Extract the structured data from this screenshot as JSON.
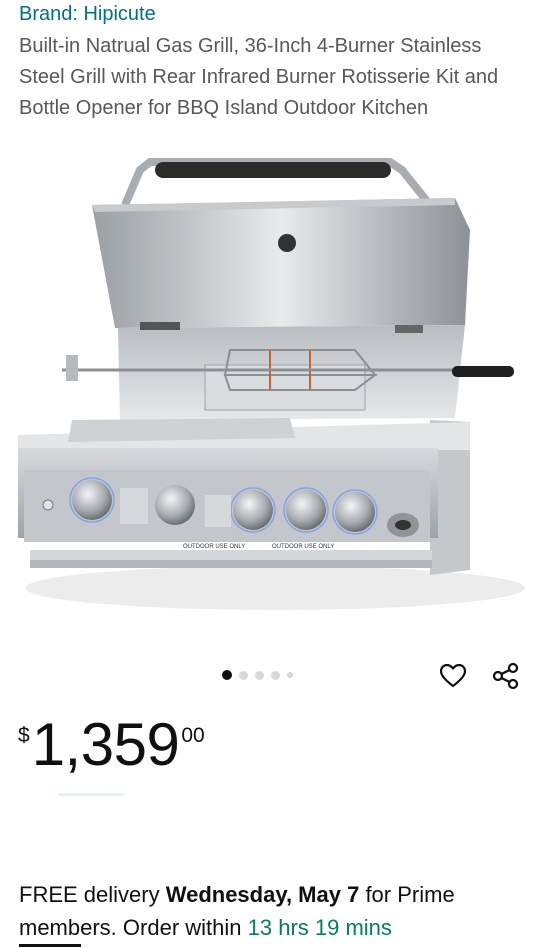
{
  "brand": {
    "label": "Brand: Hipicute"
  },
  "product": {
    "title": "Built-in Natrual Gas Grill, 36-Inch 4-Burner Stainless Steel Grill with Rear Infrared Burner Rotisserie Kit and Bottle Opener for BBQ Island Outdoor Kitchen",
    "image_labels": {
      "outdoor_use_1": "OUTDOOR USE ONLY",
      "outdoor_use_2": "OUTDOOR USE ONLY"
    }
  },
  "carousel": {
    "total": 5,
    "active_index": 0
  },
  "actions": {
    "wishlist_icon": "heart-icon",
    "share_icon": "share-icon"
  },
  "price": {
    "symbol": "$",
    "whole": "1,359",
    "fraction": "00"
  },
  "delivery": {
    "prefix": "FREE delivery ",
    "date": "Wednesday, May 7",
    "middle": " for Prime members. Order within ",
    "countdown": "13 hrs 19 mins"
  },
  "colors": {
    "link": "#007185",
    "countdown": "#067d62",
    "text": "#0f1111",
    "subtle": "#565959"
  }
}
